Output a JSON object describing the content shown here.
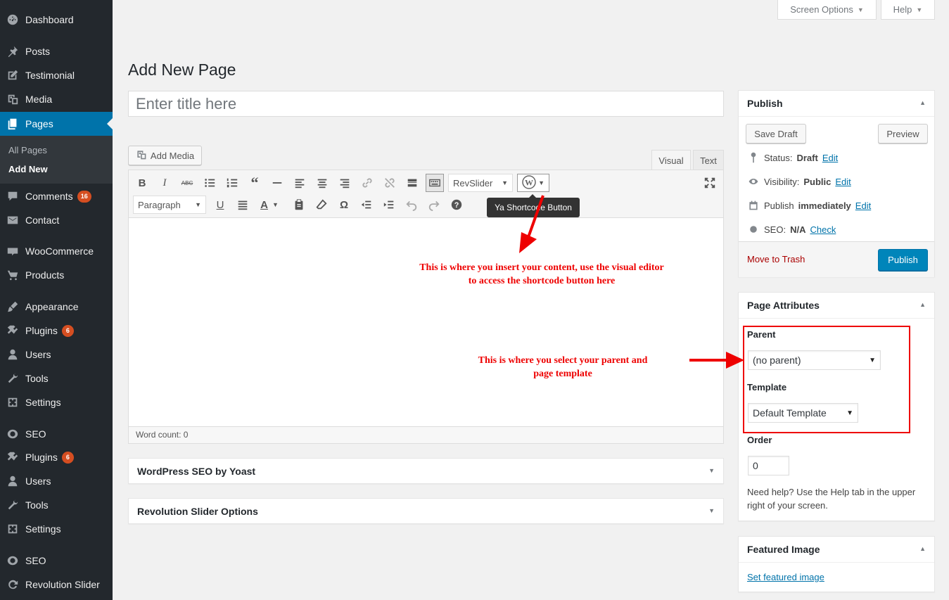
{
  "sidebar": {
    "items": [
      {
        "label": "Dashboard",
        "icon": "dashboard-icon"
      },
      {
        "label": "Posts",
        "icon": "pin-icon"
      },
      {
        "label": "Testimonial",
        "icon": "edit-icon"
      },
      {
        "label": "Media",
        "icon": "media-icon"
      },
      {
        "label": "Pages",
        "icon": "pages-icon",
        "active": true
      },
      {
        "label": "Comments",
        "icon": "comments-icon",
        "badge": "16"
      },
      {
        "label": "Contact",
        "icon": "mail-icon"
      },
      {
        "label": "WooCommerce",
        "icon": "woocommerce-icon"
      },
      {
        "label": "Products",
        "icon": "cart-icon"
      },
      {
        "label": "Appearance",
        "icon": "appearance-icon"
      },
      {
        "label": "Plugins",
        "icon": "plugin-icon",
        "badge": "6"
      },
      {
        "label": "Users",
        "icon": "users-icon"
      },
      {
        "label": "Tools",
        "icon": "wrench-icon"
      },
      {
        "label": "Settings",
        "icon": "settings-icon"
      },
      {
        "label": "SEO",
        "icon": "seo-icon"
      },
      {
        "label": "Plugins",
        "icon": "plugin-icon",
        "badge": "6"
      },
      {
        "label": "Users",
        "icon": "users-icon"
      },
      {
        "label": "Tools",
        "icon": "wrench-icon"
      },
      {
        "label": "Settings",
        "icon": "settings-icon"
      },
      {
        "label": "SEO",
        "icon": "seo-icon"
      },
      {
        "label": "Revolution Slider",
        "icon": "refresh-icon"
      }
    ],
    "submenu": [
      {
        "label": "All Pages"
      },
      {
        "label": "Add New",
        "current": true
      }
    ]
  },
  "header": {
    "screen_options": "Screen Options",
    "help": "Help"
  },
  "main": {
    "title": "Add New Page",
    "title_placeholder": "Enter title here",
    "add_media": "Add Media",
    "tabs": {
      "visual": "Visual",
      "text": "Text"
    },
    "toolbar": {
      "revslider": "RevSlider",
      "paragraph": "Paragraph",
      "tooltip": "Ya Shortcode Button"
    },
    "word_count": "Word count: 0",
    "metaboxes": {
      "yoast": "WordPress SEO by Yoast",
      "revolution": "Revolution Slider Options"
    }
  },
  "publish": {
    "title": "Publish",
    "save_draft": "Save Draft",
    "preview": "Preview",
    "status_label": "Status:",
    "status_value": "Draft",
    "visibility_label": "Visibility:",
    "visibility_value": "Public",
    "publish_label": "Publish",
    "publish_value": "immediately",
    "seo_label": "SEO:",
    "seo_value": "N/A",
    "edit": "Edit",
    "check": "Check",
    "move_to_trash": "Move to Trash",
    "publish_button": "Publish"
  },
  "page_attributes": {
    "title": "Page Attributes",
    "parent_label": "Parent",
    "parent_value": "(no parent)",
    "template_label": "Template",
    "template_value": "Default Template",
    "order_label": "Order",
    "order_value": "0",
    "help_text": "Need help? Use the Help tab in the upper right of your screen."
  },
  "featured_image": {
    "title": "Featured Image",
    "link": "Set featured image"
  },
  "annotations": {
    "content_note": "This is where you insert your content, use the visual editor to access the shortcode button here",
    "parent_note": "This is where you select your parent and page template"
  },
  "colors": {
    "sidebar_bg": "#23282d",
    "active_menu": "#0073aa",
    "publish_button": "#0085ba",
    "annotation": "#e00000",
    "badge": "#d54e21"
  }
}
